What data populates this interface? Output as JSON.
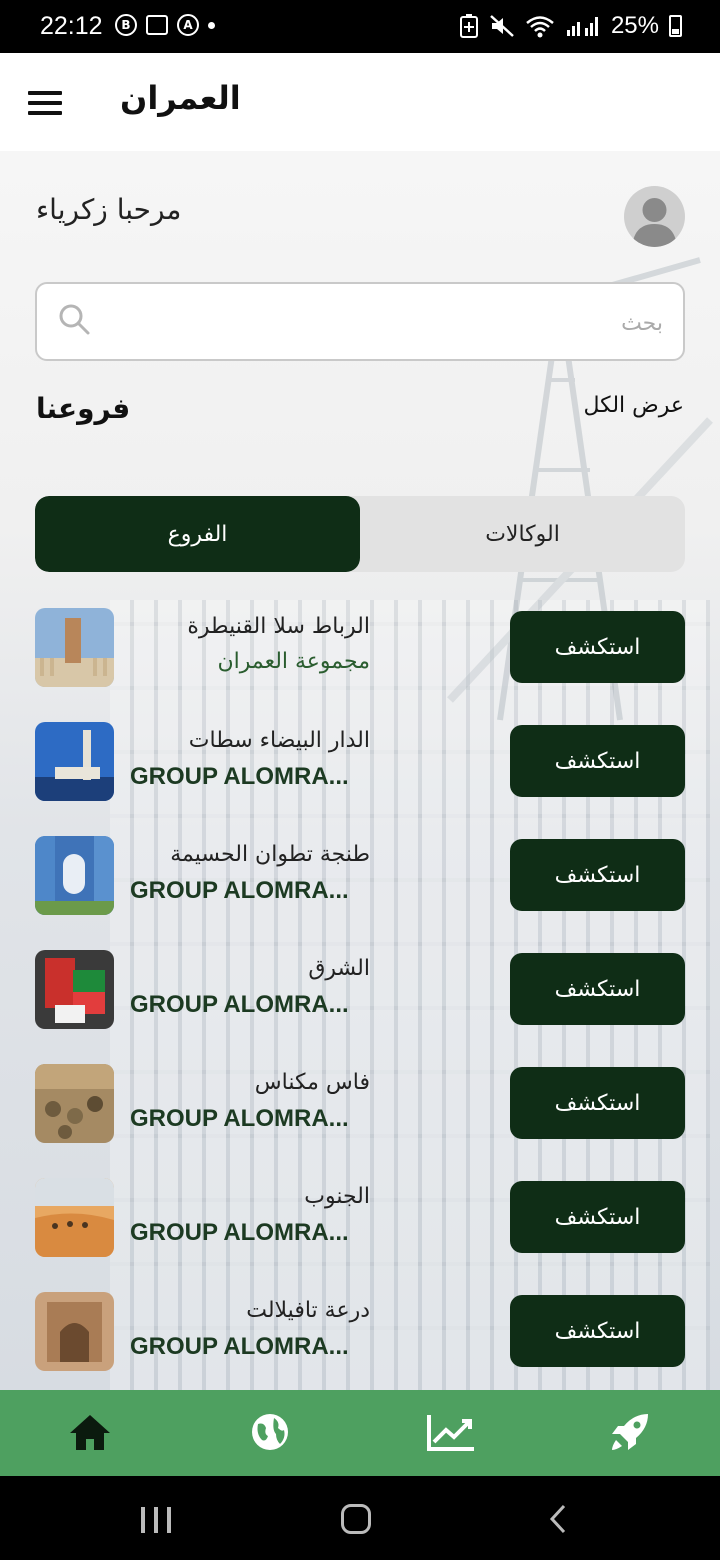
{
  "status_bar": {
    "time": "22:12",
    "battery": "25%",
    "icons_left": [
      "b-circle-icon",
      "image-icon",
      "a-circle-icon",
      "dot-icon"
    ],
    "icons_right": [
      "battery-saver-icon",
      "mute-icon",
      "wifi-icon",
      "signal-icon"
    ]
  },
  "appbar": {
    "title": "العمران",
    "menu_icon": "hamburger-icon"
  },
  "greeting": "مرحبا زكرياء",
  "search": {
    "placeholder": "بحث",
    "icon": "search-icon"
  },
  "section": {
    "title": "فروعنا",
    "view_all": "عرض الكل"
  },
  "toggle": {
    "active": "الفروع",
    "inactive": "الوكالات"
  },
  "branches": [
    {
      "region": "الرباط سلا القنيطرة",
      "group": "مجموعة العمران",
      "button": "استكشف"
    },
    {
      "region": "الدار البيضاء سطات",
      "group": "GROUP ALOMRA...",
      "button": "استكشف"
    },
    {
      "region": "طنجة تطوان الحسيمة",
      "group": "GROUP ALOMRA...",
      "button": "استكشف"
    },
    {
      "region": "الشرق",
      "group": "GROUP ALOMRA...",
      "button": "استكشف"
    },
    {
      "region": "فاس مكناس",
      "group": "GROUP ALOMRA...",
      "button": "استكشف"
    },
    {
      "region": "الجنوب",
      "group": "GROUP ALOMRA...",
      "button": "استكشف"
    },
    {
      "region": "درعة تافيلالت",
      "group": "GROUP ALOMRA...",
      "button": "استكشف"
    }
  ],
  "bottom_nav": [
    "home-icon",
    "globe-icon",
    "chart-icon",
    "rocket-icon"
  ],
  "colors": {
    "primary_dark": "#0f2d16",
    "nav_green": "#4ea060"
  }
}
